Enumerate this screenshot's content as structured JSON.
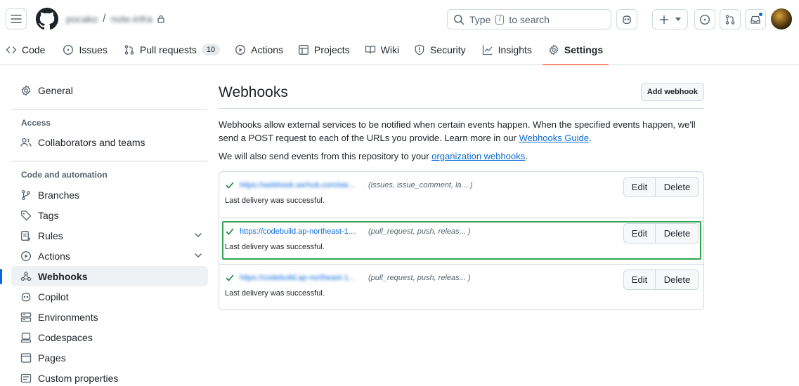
{
  "repo": {
    "owner": "pocako",
    "name": "note-infra",
    "separator": "/"
  },
  "search": {
    "placeholder_prefix": "Type",
    "key": "/",
    "placeholder_suffix": "to search"
  },
  "tabs": [
    {
      "label": "Code",
      "icon": "code-icon"
    },
    {
      "label": "Issues",
      "icon": "issue-opened-icon"
    },
    {
      "label": "Pull requests",
      "icon": "git-pull-request-icon",
      "count": "10"
    },
    {
      "label": "Actions",
      "icon": "play-icon"
    },
    {
      "label": "Projects",
      "icon": "table-icon"
    },
    {
      "label": "Wiki",
      "icon": "book-icon"
    },
    {
      "label": "Security",
      "icon": "shield-icon"
    },
    {
      "label": "Insights",
      "icon": "graph-icon"
    },
    {
      "label": "Settings",
      "icon": "gear-icon",
      "active": true
    }
  ],
  "sidebar": {
    "general": "General",
    "access_heading": "Access",
    "collaborators": "Collaborators and teams",
    "code_heading": "Code and automation",
    "items": [
      {
        "label": "Branches",
        "icon": "git-branch-icon"
      },
      {
        "label": "Tags",
        "icon": "tag-icon"
      },
      {
        "label": "Rules",
        "icon": "rules-icon",
        "expandable": true
      },
      {
        "label": "Actions",
        "icon": "play-icon",
        "expandable": true
      },
      {
        "label": "Webhooks",
        "icon": "webhook-icon",
        "active": true
      },
      {
        "label": "Copilot",
        "icon": "copilot-icon"
      },
      {
        "label": "Environments",
        "icon": "server-icon"
      },
      {
        "label": "Codespaces",
        "icon": "codespaces-icon"
      },
      {
        "label": "Pages",
        "icon": "browser-icon"
      },
      {
        "label": "Custom properties",
        "icon": "note-icon"
      }
    ]
  },
  "main": {
    "title": "Webhooks",
    "add_button": "Add webhook",
    "description": "Webhooks allow external services to be notified when certain events happen. When the specified events happen, we'll send a POST request to each of the URLs you provide. Learn more in our",
    "guide_link": "Webhooks Guide",
    "description_end": ".",
    "org_text": "We will also send events from this repository to your",
    "org_link": "organization webhooks",
    "org_end": ".",
    "webhooks": [
      {
        "url": "https://webhook.serhub.com/we...",
        "events": "(issues, issue_comment, la... )",
        "status": "Last delivery was successful.",
        "edit": "Edit",
        "delete": "Delete",
        "blurred": true
      },
      {
        "url": "https://codebuild.ap-northeast-1....",
        "events": "(pull_request, push, releas... )",
        "status": "Last delivery was successful.",
        "edit": "Edit",
        "delete": "Delete",
        "highlighted": true
      },
      {
        "url": "https://codebuild.ap-northeast-1...",
        "events": "(pull_request, push, releas... )",
        "status": "Last delivery was successful.",
        "edit": "Edit",
        "delete": "Delete",
        "blurred": true
      }
    ]
  },
  "colors": {
    "accent": "#0969da",
    "tab_underline": "#fd8c73",
    "success": "#1a7f37",
    "highlight": "#2da44e"
  }
}
